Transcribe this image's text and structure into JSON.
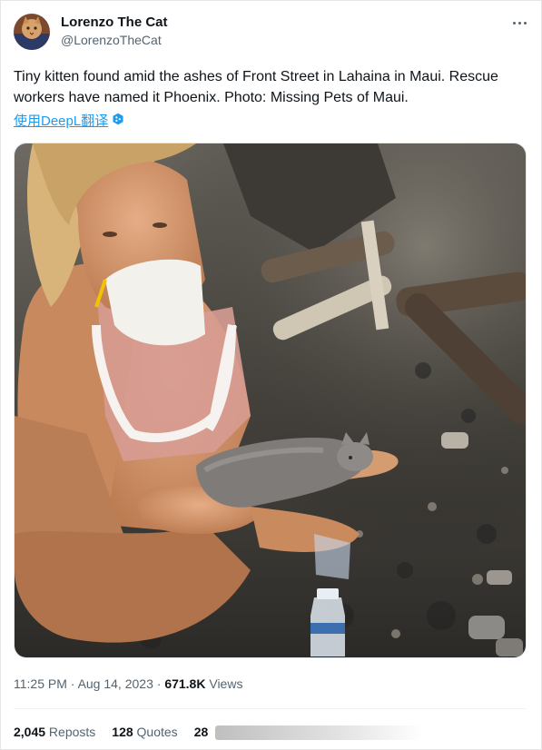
{
  "author": {
    "name": "Lorenzo The Cat",
    "handle": "@LorenzoTheCat"
  },
  "more_icon": "more-horizontal-icon",
  "tweet": {
    "text": "Tiny kitten found amid the ashes of Front Street in Lahaina in Maui. Rescue workers have named it Phoenix. Photo: Missing Pets of Maui.",
    "translate_label": "使用DeepL翻译"
  },
  "meta": {
    "time": "11:25 PM",
    "sep1": " · ",
    "date": "Aug 14, 2023",
    "sep2": " · ",
    "views_count": "671.8K",
    "views_label": " Views"
  },
  "stats": {
    "reposts_count": "2,045",
    "reposts_label": " Reposts",
    "quotes_count": "128",
    "quotes_label": " Quotes",
    "likes_partial": "28"
  },
  "colors": {
    "link": "#1d9bf0",
    "muted": "#536471",
    "text": "#0f1419"
  }
}
